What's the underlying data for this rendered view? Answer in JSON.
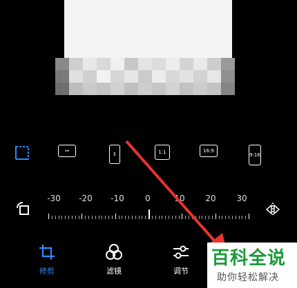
{
  "ratio_options": [
    {
      "name": "free-crop",
      "label": ""
    },
    {
      "name": "horizontal-flip",
      "label": ""
    },
    {
      "name": "vertical-flip",
      "label": ""
    },
    {
      "name": "ratio-1-1",
      "label": "1:1"
    },
    {
      "name": "ratio-16-9",
      "label": "16:9"
    },
    {
      "name": "ratio-9-16",
      "label": "9:16"
    }
  ],
  "ruler": {
    "labels": [
      "-30",
      "-20",
      "-10",
      "0",
      "10",
      "20",
      "30"
    ]
  },
  "tabs": [
    {
      "label": "修剪",
      "active": true
    },
    {
      "label": "滤镜",
      "active": false
    },
    {
      "label": "调节",
      "active": false
    }
  ],
  "watermark": {
    "main": "百科全说",
    "sub": "助你轻松解决"
  },
  "colors": {
    "accent": "#2c8cff",
    "arrow": "#e8342c",
    "watermark_green": "#1a9a3a"
  }
}
